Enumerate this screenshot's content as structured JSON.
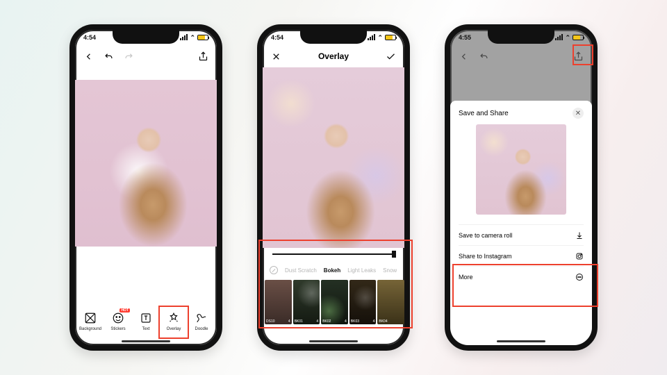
{
  "phone1": {
    "time": "4:54",
    "tools": [
      {
        "key": "background",
        "label": "Background"
      },
      {
        "key": "stickers",
        "label": "Stickers",
        "badge": "HOT"
      },
      {
        "key": "text",
        "label": "Text"
      },
      {
        "key": "overlay",
        "label": "Overlay"
      },
      {
        "key": "doodle",
        "label": "Doodle"
      }
    ],
    "active_tool": "overlay"
  },
  "phone2": {
    "time": "4:54",
    "title": "Overlay",
    "categories": [
      "Dust Scratch",
      "Bokeh",
      "Light Leaks",
      "Snow"
    ],
    "active_category": "Bokeh",
    "thumbs": [
      {
        "id": "DS10",
        "secondary": "4"
      },
      {
        "id": "BK01",
        "secondary": "4"
      },
      {
        "id": "BK02",
        "secondary": "4"
      },
      {
        "id": "BK03",
        "secondary": "4"
      },
      {
        "id": "BK04",
        "secondary": ""
      }
    ],
    "slider_value": 100
  },
  "phone3": {
    "time": "4:55",
    "sheet_title": "Save and Share",
    "actions": [
      {
        "key": "save",
        "label": "Save to camera roll",
        "icon": "download"
      },
      {
        "key": "instagram",
        "label": "Share to Instagram",
        "icon": "instagram"
      },
      {
        "key": "more",
        "label": "More",
        "icon": "more"
      }
    ]
  },
  "annotation_boxes": [
    {
      "phone": 1,
      "target": "overlay-tool"
    },
    {
      "phone": 2,
      "target": "overlay-panel"
    },
    {
      "phone": 3,
      "target": "share-button"
    },
    {
      "phone": 3,
      "target": "save-share-actions"
    }
  ]
}
